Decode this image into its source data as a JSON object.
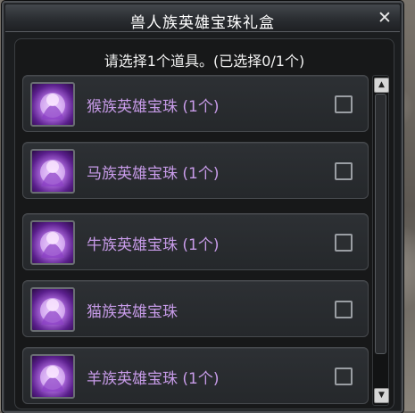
{
  "dialog": {
    "title": "兽人族英雄宝珠礼盒",
    "close_symbol": "✕",
    "prompt": "请选择1个道具。(已选择0/1个)"
  },
  "items": [
    {
      "label": "猴族英雄宝珠 (1个)",
      "checked": false,
      "icon": "hero-orb-icon"
    },
    {
      "label": "马族英雄宝珠 (1个)",
      "checked": false,
      "icon": "hero-orb-icon"
    },
    {
      "label": "牛族英雄宝珠 (1个)",
      "checked": false,
      "icon": "hero-orb-icon"
    },
    {
      "label": "猫族英雄宝珠",
      "checked": false,
      "icon": "hero-orb-icon"
    },
    {
      "label": "羊族英雄宝珠 (1个)",
      "checked": false,
      "icon": "hero-orb-icon"
    }
  ],
  "scrollbar": {
    "up_symbol": "▲",
    "down_symbol": "▼"
  },
  "colors": {
    "item_name": "#c79be8",
    "panel": "#171819"
  }
}
